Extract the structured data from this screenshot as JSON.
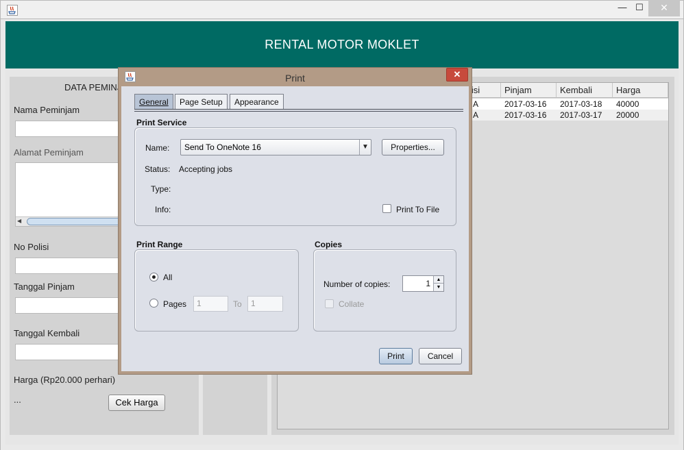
{
  "window": {
    "minimize": "—",
    "maximize": "☐",
    "close": "✕"
  },
  "app": {
    "title": "RENTAL MOTOR MOKLET"
  },
  "form": {
    "section_title": "DATA PEMINJA",
    "nama_label": "Nama Peminjam",
    "alamat_label": "Alamat Peminjam",
    "polisi_label": "No Polisi",
    "pinjam_label": "Tanggal Pinjam",
    "kembali_label": "Tanggal Kembali",
    "harga_label": "Harga (Rp20.000 perhari)",
    "harga_value": "...",
    "cek_button": "Cek Harga"
  },
  "table": {
    "columns": [
      "lisi",
      "Pinjam",
      "Kembali",
      "Harga"
    ],
    "rows": [
      [
        "A",
        "2017-03-16",
        "2017-03-18",
        "40000"
      ],
      [
        "A",
        "2017-03-16",
        "2017-03-17",
        "20000"
      ]
    ]
  },
  "dialog": {
    "title": "Print",
    "close": "✕",
    "tabs": [
      "General",
      "Page Setup",
      "Appearance"
    ],
    "active_tab": "General",
    "print_service": {
      "title": "Print Service",
      "name_label": "Name:",
      "name_value": "Send To OneNote 16",
      "properties_button": "Properties...",
      "status_label": "Status:",
      "status_value": "Accepting jobs",
      "type_label": "Type:",
      "info_label": "Info:",
      "print_to_file_label": "Print To File",
      "print_to_file_checked": false
    },
    "print_range": {
      "title": "Print Range",
      "all_label": "All",
      "pages_label": "Pages",
      "from_value": "1",
      "to_label": "To",
      "to_value": "1",
      "selected": "All"
    },
    "copies": {
      "title": "Copies",
      "number_label": "Number of copies:",
      "number_value": "1",
      "collate_label": "Collate",
      "collate_enabled": false
    },
    "print_button": "Print",
    "cancel_button": "Cancel"
  },
  "colors": {
    "header": "#006a63",
    "dialog_frame": "#b39b86",
    "close_red": "#c74a3c"
  }
}
